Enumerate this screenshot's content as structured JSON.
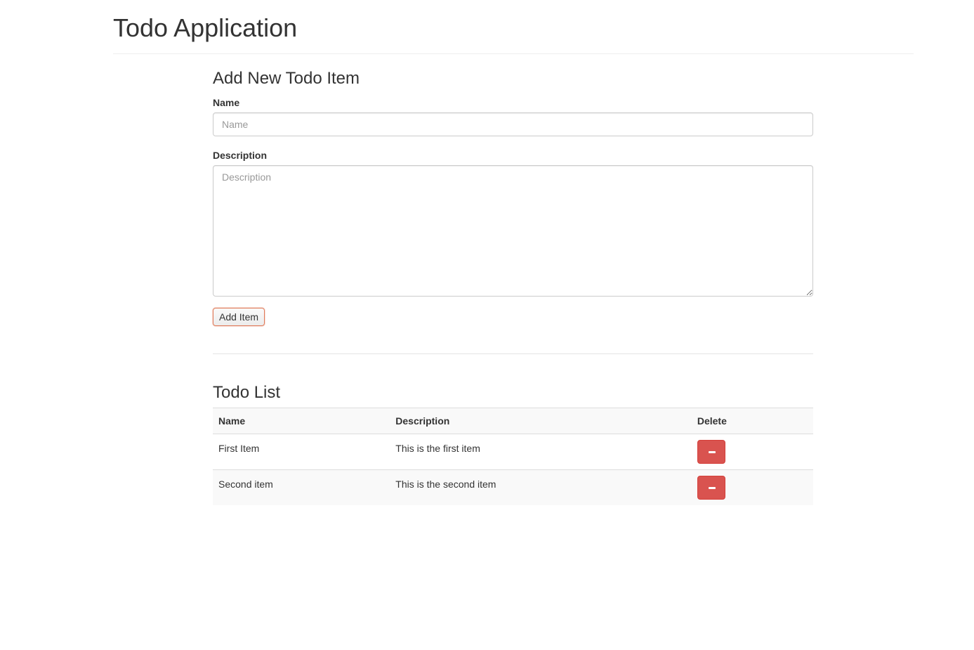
{
  "header": {
    "title": "Todo Application"
  },
  "form": {
    "title": "Add New Todo Item",
    "name_label": "Name",
    "name_placeholder": "Name",
    "name_value": "",
    "description_label": "Description",
    "description_placeholder": "Description",
    "description_value": "",
    "add_button_label": "Add Item"
  },
  "list": {
    "title": "Todo List",
    "columns": [
      "Name",
      "Description",
      "Delete"
    ],
    "rows": [
      {
        "name": "First Item",
        "description": "This is the first item",
        "delete_icon": "minus-icon"
      },
      {
        "name": "Second item",
        "description": "This is the second item",
        "delete_icon": "minus-icon"
      }
    ]
  },
  "colors": {
    "delete_button": "#d9534f",
    "add_button_border": "#e07b5a"
  }
}
